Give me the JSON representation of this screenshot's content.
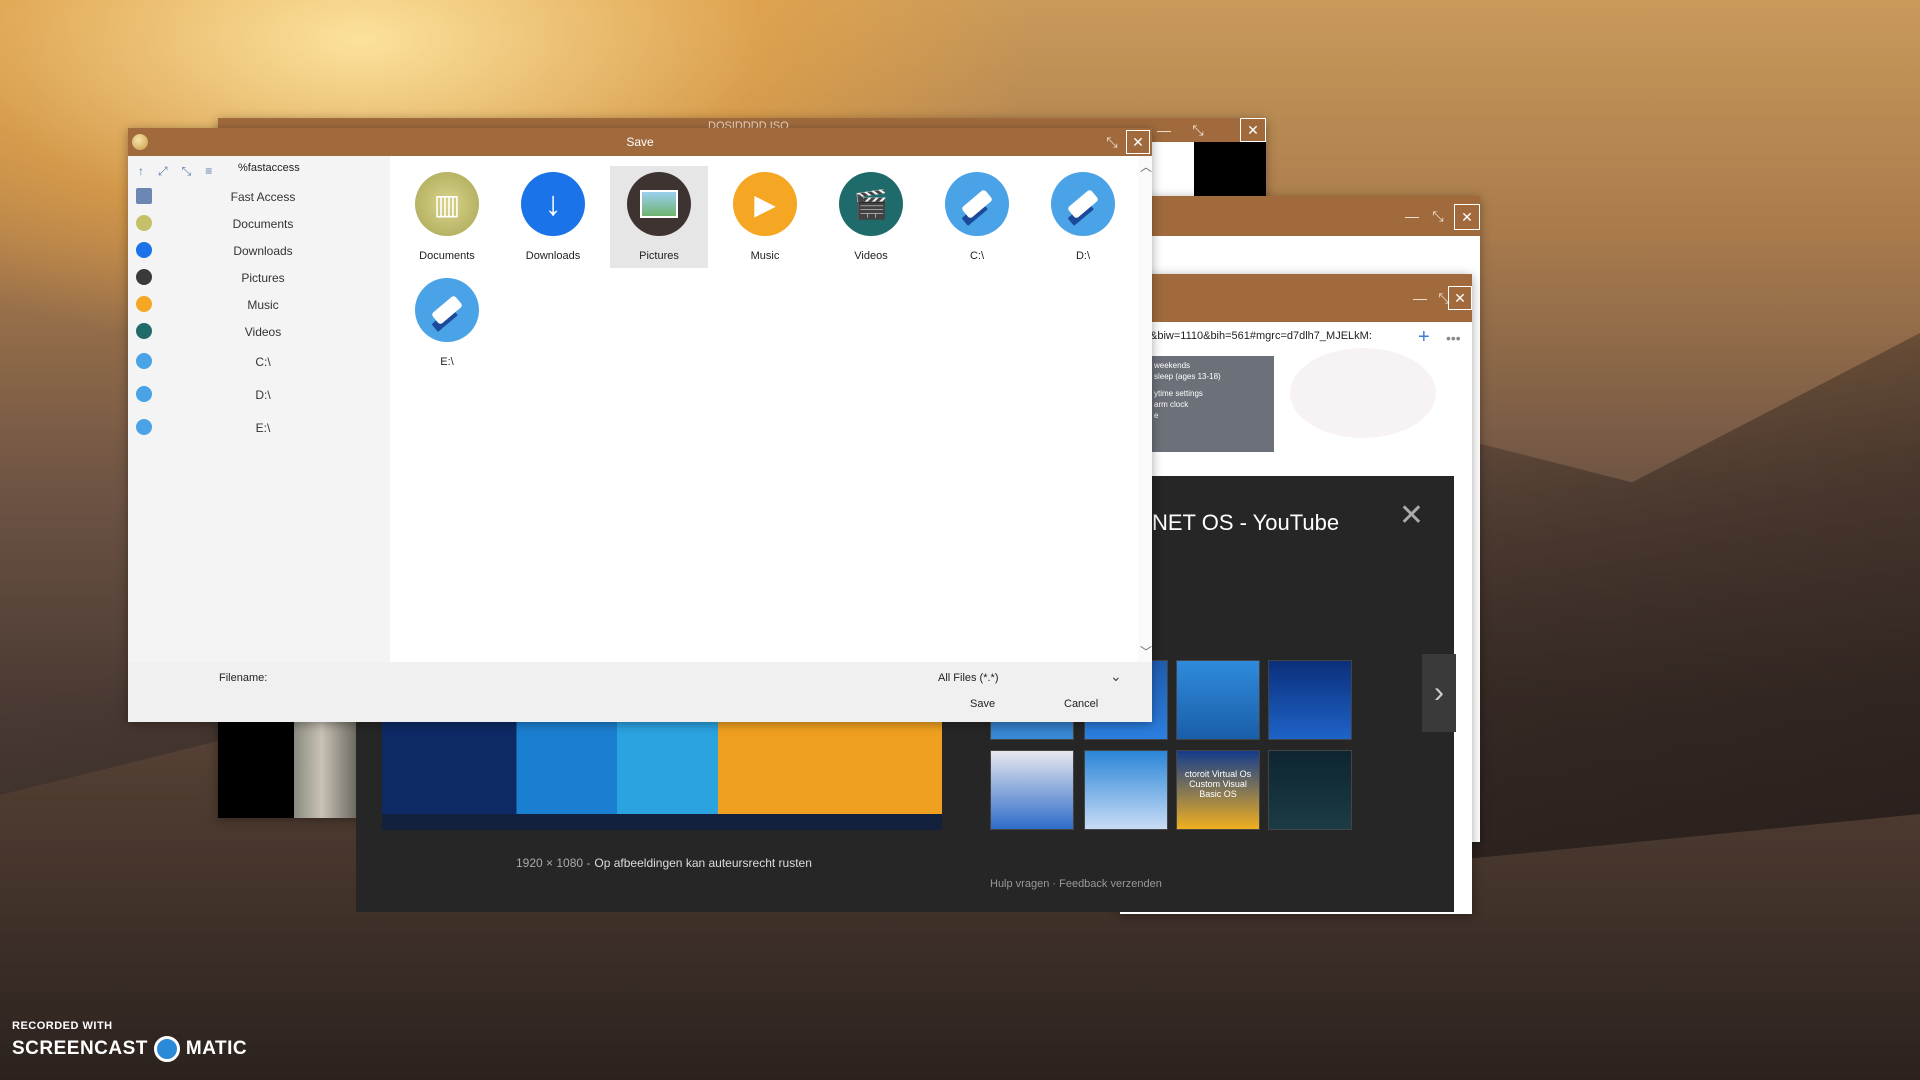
{
  "desktop": {
    "watermark_top": "RECORDED WITH",
    "watermark_left": "SCREENCAST",
    "watermark_right": "MATIC"
  },
  "background_windows": {
    "win1_title": "DOSIDDDD.ISO",
    "browser_url": "&biw=1110&bih=561#mgrc=d7dlh7_MJELkM:",
    "menu_lines": [
      "weekends",
      "sleep (ages 13-18)",
      "ytime settings",
      "arm clock",
      "e"
    ],
    "youtube_title": "NET OS - YouTube",
    "image_meta_size": "1920 × 1080 -",
    "image_meta_note": "Op afbeeldingen kan auteursrecht rusten",
    "help_link": "Hulp vragen",
    "feedback_link": "Feedback verzenden",
    "thumb_caption": "ctoroit Virtual Os Custom Visual Basic OS"
  },
  "dialog": {
    "title": "Save",
    "path": "%fastaccess",
    "sidebar": [
      {
        "label": "Fast Access",
        "icon": "fast-access-icon"
      },
      {
        "label": "Documents",
        "icon": "documents-icon"
      },
      {
        "label": "Downloads",
        "icon": "downloads-icon"
      },
      {
        "label": "Pictures",
        "icon": "pictures-icon"
      },
      {
        "label": "Music",
        "icon": "music-icon"
      },
      {
        "label": "Videos",
        "icon": "videos-icon"
      },
      {
        "label": "C:\\",
        "icon": "drive-icon"
      },
      {
        "label": "D:\\",
        "icon": "drive-icon"
      },
      {
        "label": "E:\\",
        "icon": "drive-icon"
      }
    ],
    "tiles": [
      {
        "label": "Documents",
        "icon": "documents-icon"
      },
      {
        "label": "Downloads",
        "icon": "downloads-icon"
      },
      {
        "label": "Pictures",
        "icon": "pictures-icon",
        "selected": true
      },
      {
        "label": "Music",
        "icon": "music-icon"
      },
      {
        "label": "Videos",
        "icon": "videos-icon"
      },
      {
        "label": "C:\\",
        "icon": "drive-icon"
      },
      {
        "label": "D:\\",
        "icon": "drive-icon"
      },
      {
        "label": "E:\\",
        "icon": "drive-icon"
      }
    ],
    "filename_label": "Filename:",
    "filename_value": "",
    "filter": "All Files (*.*)",
    "save_label": "Save",
    "cancel_label": "Cancel"
  },
  "colors": {
    "titlebar": "#a06a3c",
    "downloads": "#1a73e8",
    "music": "#f5a623",
    "videos": "#1f6b6b",
    "drive": "#4aa3e6",
    "documents": "#c6c06a"
  }
}
